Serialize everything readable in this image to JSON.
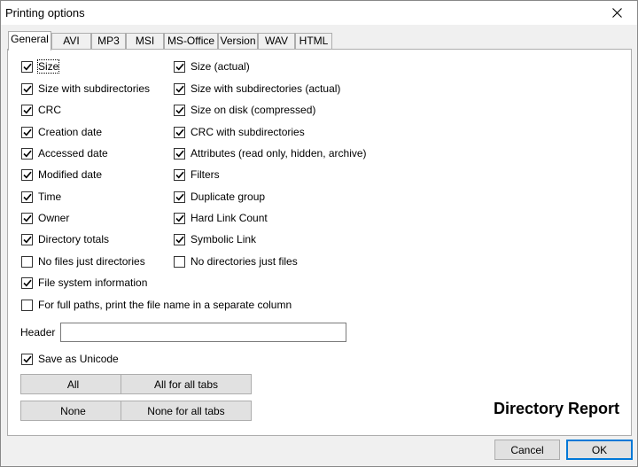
{
  "window": {
    "title": "Printing options"
  },
  "tabs": [
    {
      "label": "General",
      "active": true
    },
    {
      "label": "AVI"
    },
    {
      "label": "MP3"
    },
    {
      "label": "MSI"
    },
    {
      "label": "MS-Office"
    },
    {
      "label": "Version"
    },
    {
      "label": "WAV"
    },
    {
      "label": "HTML"
    }
  ],
  "left_options": [
    {
      "label": "Size",
      "checked": true
    },
    {
      "label": "Size with subdirectories",
      "checked": true
    },
    {
      "label": "CRC",
      "checked": true
    },
    {
      "label": "Creation date",
      "checked": true
    },
    {
      "label": "Accessed date",
      "checked": true
    },
    {
      "label": "Modified date",
      "checked": true
    },
    {
      "label": "Time",
      "checked": true
    },
    {
      "label": "Owner",
      "checked": true
    },
    {
      "label": "Directory totals",
      "checked": true
    },
    {
      "label": "No files just directories",
      "checked": false
    },
    {
      "label": "File system information",
      "checked": true
    }
  ],
  "right_options": [
    {
      "label": "Size (actual)",
      "checked": true
    },
    {
      "label": "Size with subdirectories (actual)",
      "checked": true
    },
    {
      "label": "Size on disk (compressed)",
      "checked": true
    },
    {
      "label": "CRC with subdirectories",
      "checked": true
    },
    {
      "label": "Attributes (read only, hidden, archive)",
      "checked": true
    },
    {
      "label": "Filters",
      "checked": true
    },
    {
      "label": "Duplicate group",
      "checked": true
    },
    {
      "label": "Hard Link Count",
      "checked": true
    },
    {
      "label": "Symbolic Link",
      "checked": true
    },
    {
      "label": "No directories just files",
      "checked": false
    }
  ],
  "full_paths_option": {
    "label": "For full paths, print the file name in a separate column",
    "checked": false
  },
  "header": {
    "label": "Header",
    "value": ""
  },
  "unicode_option": {
    "label": "Save as Unicode",
    "checked": true
  },
  "buttons": {
    "all": "All",
    "all_for_all_tabs": "All for all tabs",
    "none": "None",
    "none_for_all_tabs": "None for all tabs"
  },
  "report_title": "Directory Report",
  "dialog_buttons": {
    "cancel": "Cancel",
    "ok": "OK"
  }
}
